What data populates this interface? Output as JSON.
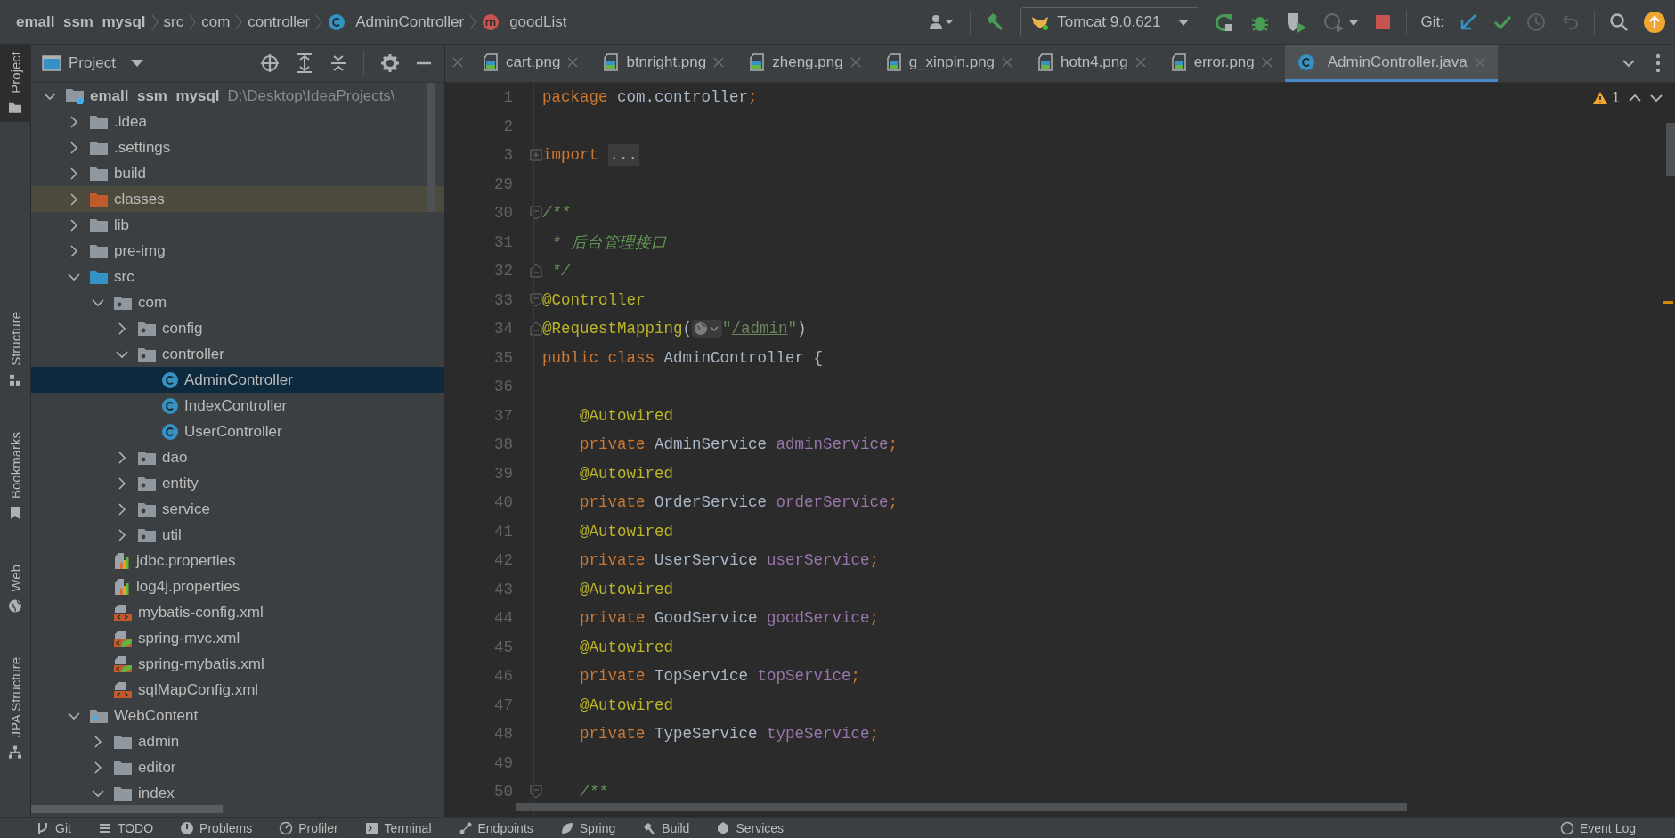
{
  "breadcrumbs": [
    {
      "label": "emall_ssm_mysql",
      "kind": "project"
    },
    {
      "label": "src",
      "kind": "folder"
    },
    {
      "label": "com",
      "kind": "folder"
    },
    {
      "label": "controller",
      "kind": "folder"
    },
    {
      "label": "AdminController",
      "kind": "class"
    },
    {
      "label": "goodList",
      "kind": "method"
    }
  ],
  "toolbar": {
    "run_config": "Tomcat 9.0.621",
    "git_label": "Git:"
  },
  "tool_strip": [
    {
      "label": "Project",
      "selected": true
    },
    {
      "label": "Structure",
      "selected": false
    },
    {
      "label": "Bookmarks",
      "selected": false
    },
    {
      "label": "Web",
      "selected": false
    },
    {
      "label": "JPA Structure",
      "selected": false
    }
  ],
  "project_panel": {
    "title": "Project",
    "tree": [
      {
        "name": "emall_ssm_mysql",
        "path": "D:\\Desktop\\IdeaProjects\\",
        "kind": "module",
        "expanded": true,
        "selected": false,
        "children": [
          {
            "name": ".idea",
            "kind": "folder",
            "expanded": false,
            "selected": false
          },
          {
            "name": ".settings",
            "kind": "folder",
            "expanded": false,
            "selected": false
          },
          {
            "name": "build",
            "kind": "folder",
            "expanded": false,
            "selected": false
          },
          {
            "name": "classes",
            "kind": "excluded-folder",
            "expanded": false,
            "selected": false
          },
          {
            "name": "lib",
            "kind": "folder",
            "expanded": false,
            "selected": false
          },
          {
            "name": "pre-img",
            "kind": "folder",
            "expanded": false,
            "selected": false
          },
          {
            "name": "src",
            "kind": "source-folder",
            "expanded": true,
            "selected": false,
            "children": [
              {
                "name": "com",
                "kind": "package",
                "expanded": true,
                "selected": false,
                "children": [
                  {
                    "name": "config",
                    "kind": "package",
                    "expanded": false,
                    "selected": false
                  },
                  {
                    "name": "controller",
                    "kind": "package",
                    "expanded": true,
                    "selected": false,
                    "children": [
                      {
                        "name": "AdminController",
                        "kind": "class",
                        "selected": true
                      },
                      {
                        "name": "IndexController",
                        "kind": "class",
                        "selected": false
                      },
                      {
                        "name": "UserController",
                        "kind": "class",
                        "selected": false
                      }
                    ]
                  },
                  {
                    "name": "dao",
                    "kind": "package",
                    "expanded": false,
                    "selected": false
                  },
                  {
                    "name": "entity",
                    "kind": "package",
                    "expanded": false,
                    "selected": false
                  },
                  {
                    "name": "service",
                    "kind": "package",
                    "expanded": false,
                    "selected": false
                  },
                  {
                    "name": "util",
                    "kind": "package",
                    "expanded": false,
                    "selected": false
                  }
                ]
              },
              {
                "name": "jdbc.properties",
                "kind": "properties",
                "selected": false
              },
              {
                "name": "log4j.properties",
                "kind": "properties",
                "selected": false
              },
              {
                "name": "mybatis-config.xml",
                "kind": "xml",
                "selected": false
              },
              {
                "name": "spring-mvc.xml",
                "kind": "spring-xml",
                "selected": false
              },
              {
                "name": "spring-mybatis.xml",
                "kind": "spring-xml",
                "selected": false
              },
              {
                "name": "sqlMapConfig.xml",
                "kind": "xml",
                "selected": false
              }
            ]
          },
          {
            "name": "WebContent",
            "kind": "web-folder",
            "expanded": true,
            "selected": false,
            "children": [
              {
                "name": "admin",
                "kind": "folder",
                "expanded": false,
                "selected": false
              },
              {
                "name": "editor",
                "kind": "folder",
                "expanded": false,
                "selected": false
              },
              {
                "name": "index",
                "kind": "folder",
                "expanded": true,
                "selected": false
              }
            ]
          }
        ]
      }
    ]
  },
  "editor_tabs": [
    {
      "label": "cart.png",
      "kind": "image",
      "selected": false
    },
    {
      "label": "btnright.png",
      "kind": "image",
      "selected": false
    },
    {
      "label": "zheng.png",
      "kind": "image",
      "selected": false
    },
    {
      "label": "g_xinpin.png",
      "kind": "image",
      "selected": false
    },
    {
      "label": "hotn4.png",
      "kind": "image",
      "selected": false
    },
    {
      "label": "error.png",
      "kind": "image",
      "selected": false
    },
    {
      "label": "AdminController.java",
      "kind": "class",
      "selected": true
    }
  ],
  "warnings": {
    "count": "1"
  },
  "code_lines": [
    {
      "number": "1",
      "kind": "plain",
      "tokens": [
        {
          "kind": "keyword",
          "text": "package "
        },
        {
          "kind": "plain",
          "text": "com.controller"
        },
        {
          "kind": "keyword",
          "text": ";"
        }
      ]
    },
    {
      "number": "2",
      "kind": "plain"
    },
    {
      "number": "3",
      "kind": "fold-collapsed",
      "tokens": [
        {
          "kind": "keyword",
          "text": "import "
        },
        {
          "kind": "folded",
          "text": "..."
        }
      ]
    },
    {
      "number": "29",
      "kind": "plain"
    },
    {
      "number": "30",
      "kind": "fold-start",
      "tokens": [
        {
          "kind": "comment",
          "text": "/**"
        }
      ]
    },
    {
      "number": "31",
      "kind": "plain",
      "tokens": [
        {
          "kind": "comment",
          "text": " * 后台管理接口"
        }
      ]
    },
    {
      "number": "32",
      "kind": "fold-end",
      "tokens": [
        {
          "kind": "comment",
          "text": " */"
        }
      ]
    },
    {
      "number": "33",
      "kind": "fold-start",
      "tokens": [
        {
          "kind": "annotation",
          "text": "@Controller"
        }
      ]
    },
    {
      "number": "34",
      "kind": "fold-end",
      "tokens": [
        {
          "kind": "annotation",
          "text": "@RequestMapping"
        },
        {
          "kind": "plain",
          "text": "("
        },
        {
          "kind": "url-icon"
        },
        {
          "kind": "string",
          "text": "\""
        },
        {
          "kind": "url",
          "text": "/admin"
        },
        {
          "kind": "string",
          "text": "\""
        },
        {
          "kind": "plain",
          "text": ")"
        }
      ]
    },
    {
      "number": "35",
      "kind": "plain",
      "tokens": [
        {
          "kind": "keyword",
          "text": "public class "
        },
        {
          "kind": "plain",
          "text": "AdminController {"
        }
      ]
    },
    {
      "number": "36",
      "kind": "plain"
    },
    {
      "number": "37",
      "kind": "plain",
      "tokens": [
        {
          "kind": "annotation",
          "text": "    @Autowired"
        }
      ]
    },
    {
      "number": "38",
      "kind": "plain",
      "tokens": [
        {
          "kind": "keyword",
          "text": "    private "
        },
        {
          "kind": "plain",
          "text": "AdminService "
        },
        {
          "kind": "field",
          "text": "adminService"
        },
        {
          "kind": "keyword",
          "text": ";"
        }
      ]
    },
    {
      "number": "39",
      "kind": "plain",
      "tokens": [
        {
          "kind": "annotation",
          "text": "    @Autowired"
        }
      ]
    },
    {
      "number": "40",
      "kind": "plain",
      "tokens": [
        {
          "kind": "keyword",
          "text": "    private "
        },
        {
          "kind": "plain",
          "text": "OrderService "
        },
        {
          "kind": "field",
          "text": "orderService"
        },
        {
          "kind": "keyword",
          "text": ";"
        }
      ]
    },
    {
      "number": "41",
      "kind": "plain",
      "tokens": [
        {
          "kind": "annotation",
          "text": "    @Autowired"
        }
      ]
    },
    {
      "number": "42",
      "kind": "plain",
      "tokens": [
        {
          "kind": "keyword",
          "text": "    private "
        },
        {
          "kind": "plain",
          "text": "UserService "
        },
        {
          "kind": "field",
          "text": "userService"
        },
        {
          "kind": "keyword",
          "text": ";"
        }
      ]
    },
    {
      "number": "43",
      "kind": "plain",
      "tokens": [
        {
          "kind": "annotation",
          "text": "    @Autowired"
        }
      ]
    },
    {
      "number": "44",
      "kind": "plain",
      "tokens": [
        {
          "kind": "keyword",
          "text": "    private "
        },
        {
          "kind": "plain",
          "text": "GoodService "
        },
        {
          "kind": "field",
          "text": "goodService"
        },
        {
          "kind": "keyword",
          "text": ";"
        }
      ]
    },
    {
      "number": "45",
      "kind": "plain",
      "tokens": [
        {
          "kind": "annotation",
          "text": "    @Autowired"
        }
      ]
    },
    {
      "number": "46",
      "kind": "plain",
      "tokens": [
        {
          "kind": "keyword",
          "text": "    private "
        },
        {
          "kind": "plain",
          "text": "TopService "
        },
        {
          "kind": "field",
          "text": "topService"
        },
        {
          "kind": "keyword",
          "text": ";"
        }
      ]
    },
    {
      "number": "47",
      "kind": "plain",
      "tokens": [
        {
          "kind": "annotation",
          "text": "    @Autowired"
        }
      ]
    },
    {
      "number": "48",
      "kind": "plain",
      "tokens": [
        {
          "kind": "keyword",
          "text": "    private "
        },
        {
          "kind": "plain",
          "text": "TypeService "
        },
        {
          "kind": "field",
          "text": "typeService"
        },
        {
          "kind": "keyword",
          "text": ";"
        }
      ]
    },
    {
      "number": "49",
      "kind": "plain"
    },
    {
      "number": "50",
      "kind": "fold-start",
      "tokens": [
        {
          "kind": "comment",
          "text": "    /**"
        }
      ]
    }
  ],
  "status_bar": {
    "left": [
      {
        "label": "Git",
        "kind": "git"
      },
      {
        "label": "TODO",
        "kind": "todo"
      },
      {
        "label": "Problems",
        "kind": "problems"
      },
      {
        "label": "Profiler",
        "kind": "profiler"
      },
      {
        "label": "Terminal",
        "kind": "terminal"
      },
      {
        "label": "Endpoints",
        "kind": "endpoints"
      },
      {
        "label": "Spring",
        "kind": "spring"
      },
      {
        "label": "Build",
        "kind": "build"
      },
      {
        "label": "Services",
        "kind": "services"
      }
    ],
    "right": [
      {
        "label": "Event Log",
        "kind": "event-log"
      }
    ]
  }
}
